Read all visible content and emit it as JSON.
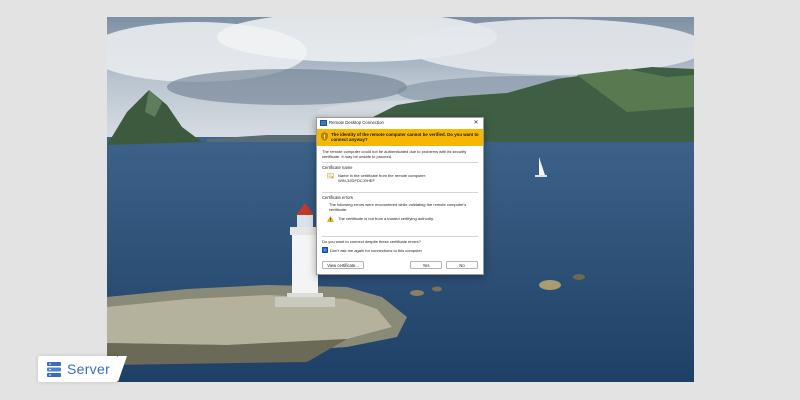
{
  "dialog": {
    "title": "Remote Desktop Connection",
    "warning": "The identity of the remote computer cannot be verified. Do you want to connect anyway?",
    "intro": "The remote computer could not be authenticated due to problems with its security certificate. It may be unsafe to proceed.",
    "certificate_name": {
      "heading": "Certificate name",
      "label": "Name in the certificate from the remote computer:",
      "value": "WIN-32DFDCJ0HEF"
    },
    "certificate_errors": {
      "heading": "Certificate errors",
      "description": "The following errors were encountered while validating the remote computer's certificate:",
      "error": "The certificate is not from a trusted certifying authority."
    },
    "question": "Do you want to connect despite these certificate errors?",
    "dont_ask": "Don't ask me again for connections to this computer",
    "dont_ask_checked": true,
    "buttons": {
      "view_certificate": "View certificate...",
      "yes": "Yes",
      "no": "No"
    }
  },
  "logo": {
    "text": "Server"
  },
  "colors": {
    "warning_banner": "#f6b700",
    "accent": "#3a6bc4"
  },
  "icons": [
    "rdp-app-icon",
    "close-icon",
    "shield-warning-icon",
    "certificate-icon",
    "warning-triangle-icon",
    "server-stack-icon"
  ]
}
